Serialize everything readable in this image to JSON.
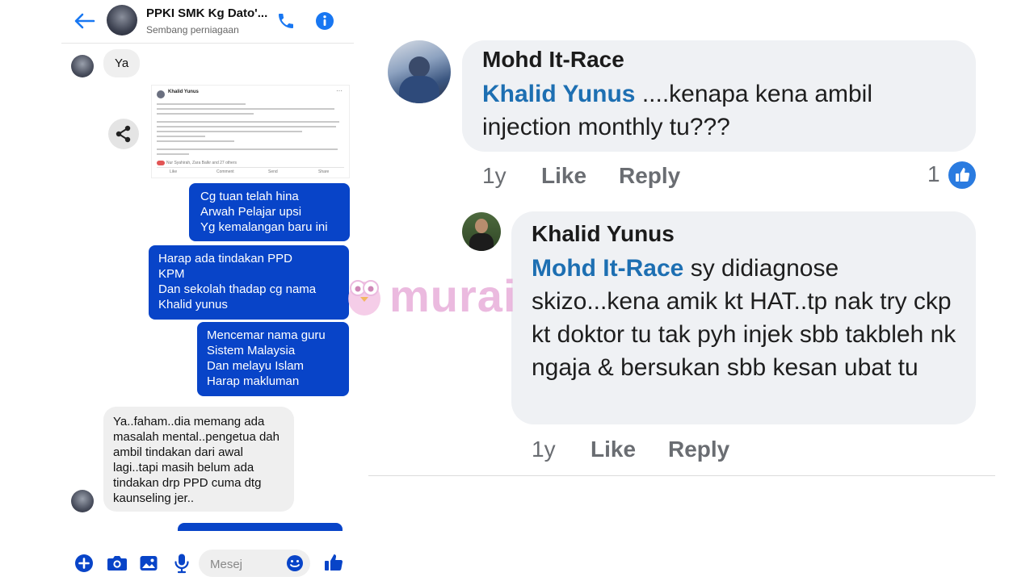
{
  "header": {
    "title": "PPKI SMK Kg Dato'...",
    "subtitle": "Sembang perniagaan"
  },
  "messages": [
    {
      "from": "them",
      "text": "Ya"
    },
    {
      "from": "them",
      "type": "shared-post"
    },
    {
      "from": "me",
      "text": "Cg tuan telah hina\nArwah Pelajar upsi\nYg kemalangan baru ini"
    },
    {
      "from": "me",
      "text": "Harap ada tindakan PPD\nKPM\nDan sekolah thadap cg nama\nKhalid yunus"
    },
    {
      "from": "me",
      "text": "Mencemar nama guru\nSistem Malaysia\nDan melayu Islam\nHarap makluman"
    },
    {
      "from": "them",
      "text": "Ya..faham..dia memang ada masalah mental..pengetua dah ambil tindakan dari awal lagi..tapi masih belum ada tindakan drp PPD cuma dtg kaunseling jer.."
    }
  ],
  "shared_post": {
    "author": "Khalid Yunus",
    "footer": "Nur Syahirah, Zara Balkr and 27 others",
    "actions": [
      "Like",
      "Comment",
      "Send",
      "Share"
    ]
  },
  "composer": {
    "placeholder": "Mesej"
  },
  "watermark": {
    "text": "murai"
  },
  "comments": [
    {
      "author": "Mohd It-Race",
      "mention": "Khalid Yunus",
      "text": "....kenapa kena ambil injection monthly tu???",
      "time": "1y",
      "like_label": "Like",
      "reply_label": "Reply",
      "reaction_count": "1"
    },
    {
      "author": "Khalid Yunus",
      "mention": "Mohd It-Race",
      "text": "sy didiagnose skizo...kena amik kt HAT..tp nak try ckp kt doktor tu tak pyh injek sbb takbleh nk ngaja & bersukan sbb kesan ubat tu",
      "time": "1y",
      "like_label": "Like",
      "reply_label": "Reply"
    }
  ],
  "colors": {
    "messenger_blue": "#0844c8",
    "icon_blue": "#1877f2",
    "fb_mention": "#1d6fb2",
    "watermark": "#e7a9d8"
  }
}
